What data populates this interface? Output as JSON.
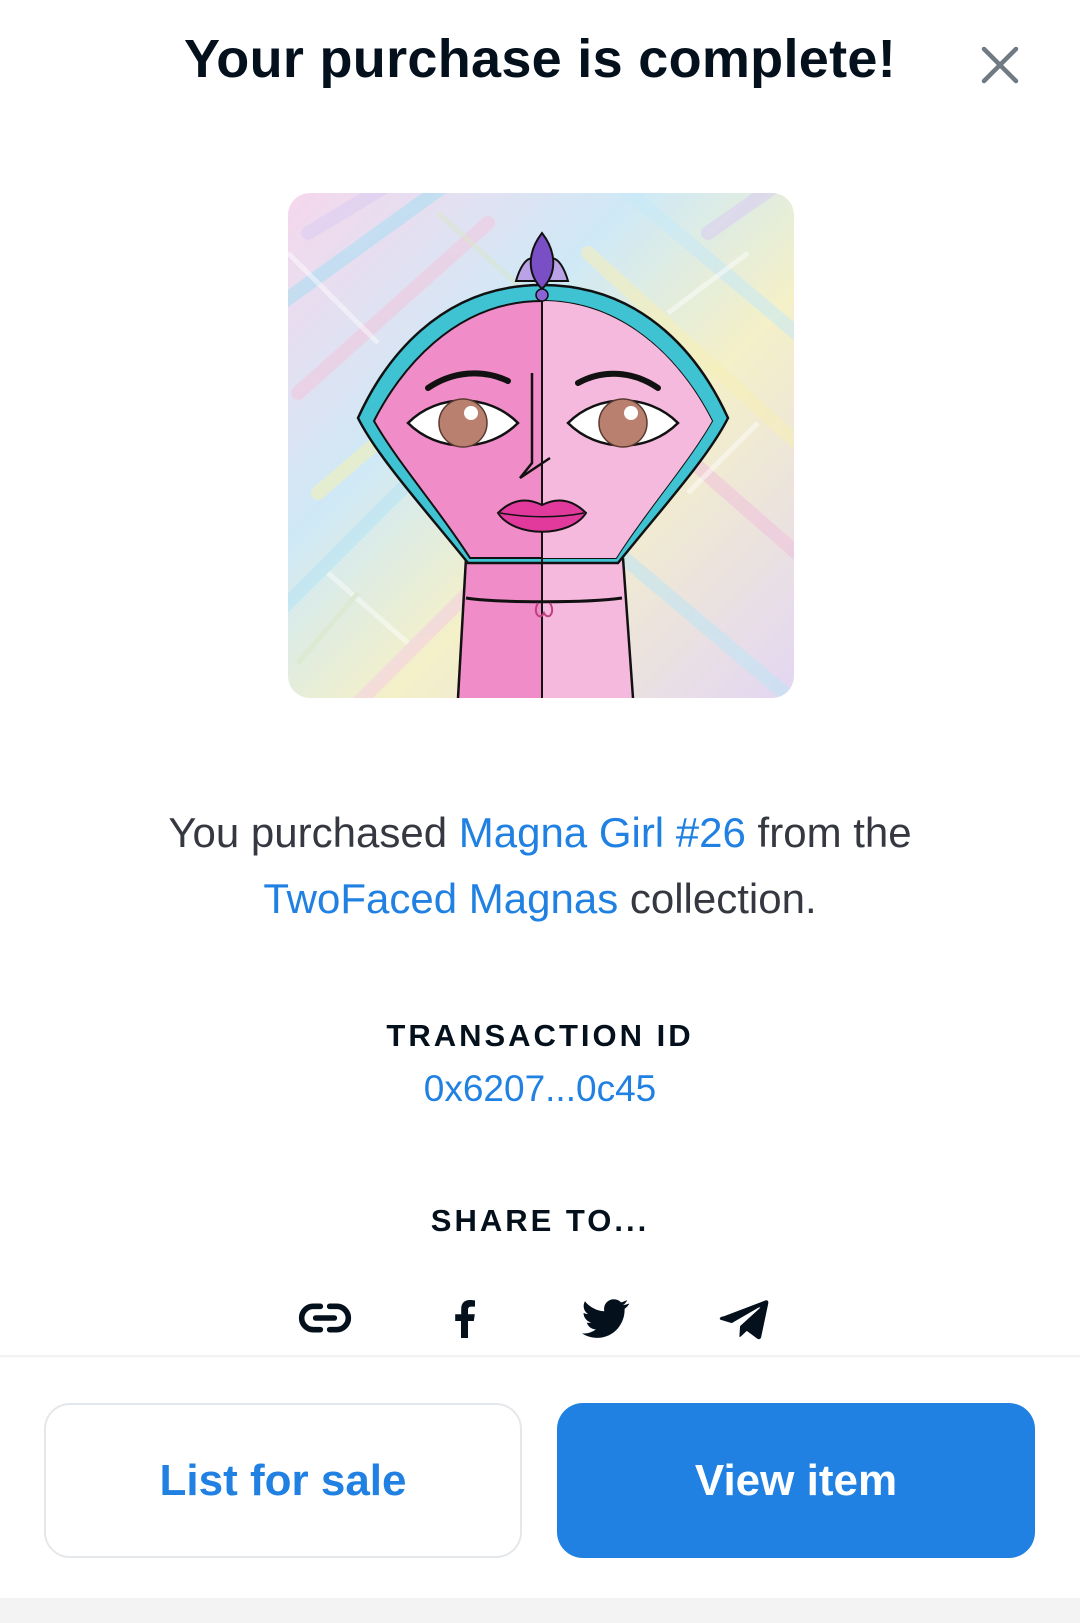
{
  "header": {
    "title": "Your purchase is complete!",
    "close_icon": "close-icon"
  },
  "nft": {
    "image_icon": "nft-artwork"
  },
  "purchase": {
    "prefix": "You purchased ",
    "item_name": "Magna Girl #26",
    "middle": " from the ",
    "collection_name": "TwoFaced Magnas",
    "suffix": " collection."
  },
  "transaction": {
    "label": "TRANSACTION ID",
    "id": "0x6207...0c45"
  },
  "share": {
    "label": "SHARE TO...",
    "icons": [
      "link-icon",
      "facebook-icon",
      "twitter-icon",
      "telegram-icon"
    ]
  },
  "actions": {
    "list_for_sale": "List for sale",
    "view_item": "View item"
  },
  "colors": {
    "accent": "#2081e2",
    "text": "#04111d",
    "body_text": "#353840"
  }
}
